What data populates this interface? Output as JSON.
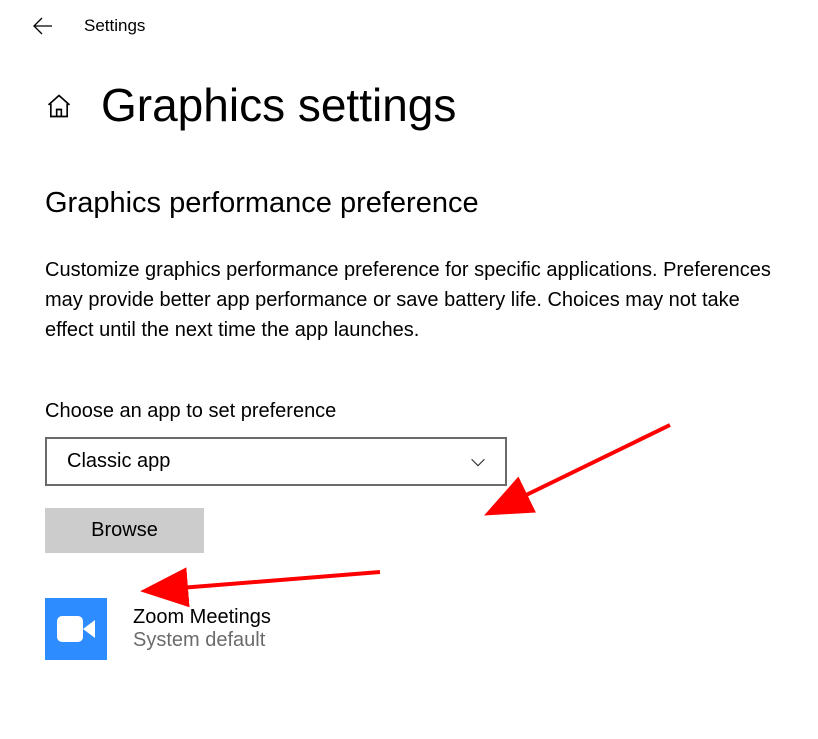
{
  "topbar": {
    "label": "Settings"
  },
  "page": {
    "heading": "Graphics settings",
    "subheading": "Graphics performance preference",
    "description": "Customize graphics performance preference for specific applications. Preferences may provide better app performance or save battery life. Choices may not take effect until the next time the app launches.",
    "choose_label": "Choose an app to set preference"
  },
  "dropdown": {
    "value": "Classic app"
  },
  "buttons": {
    "browse": "Browse"
  },
  "apps": [
    {
      "name": "Zoom Meetings",
      "preference": "System default"
    }
  ]
}
